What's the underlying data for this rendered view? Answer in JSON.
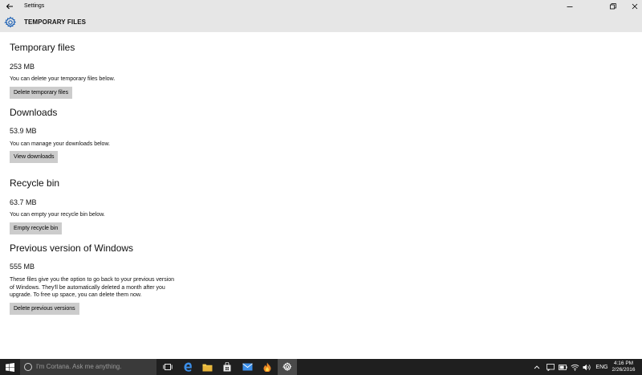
{
  "window": {
    "title": "Settings"
  },
  "header": {
    "title": "TEMPORARY FILES"
  },
  "sections": [
    {
      "title": "Temporary files",
      "size": "253 MB",
      "description": "You can delete your temporary files below.",
      "button": "Delete temporary files"
    },
    {
      "title": "Downloads",
      "size": "53.9 MB",
      "description": "You can manage your downloads below.",
      "button": "View downloads"
    },
    {
      "title": "Recycle bin",
      "size": "63.7 MB",
      "description": "You can empty your recycle bin below.",
      "button": "Empty recycle bin"
    },
    {
      "title": "Previous version of Windows",
      "size": "555 MB",
      "description_lines": [
        "These files give you the option to go back to your previous version",
        "of Windows. They'll be automatically deleted a month after you",
        "upgrade. To free up space, you can delete them now."
      ],
      "button": "Delete previous versions"
    }
  ],
  "taskbar": {
    "search_placeholder": "I'm Cortana. Ask me anything.",
    "language": "ENG",
    "time": "4:16 PM",
    "date": "2/26/2016",
    "accent": "#1f1f1f"
  }
}
